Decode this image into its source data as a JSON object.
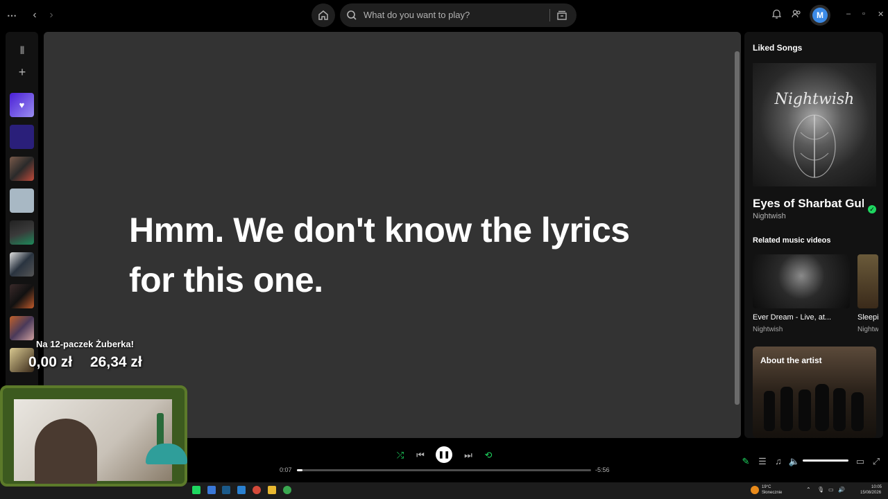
{
  "topbar": {
    "menu_icon": "more-horizontal-icon",
    "search_placeholder": "What do you want to play?",
    "avatar_initial": "M"
  },
  "sidebar": {
    "tiles": [
      {
        "name": "liked-songs",
        "color": "#6b3df0"
      },
      {
        "name": "playlist-2",
        "color": "#3a2a8f"
      },
      {
        "name": "playlist-3",
        "color": "#6a5040"
      },
      {
        "name": "playlist-4",
        "color": "#9aa6b0"
      },
      {
        "name": "playlist-5",
        "color": "#1a1a1a"
      },
      {
        "name": "playlist-6",
        "color": "#3a4650"
      },
      {
        "name": "playlist-7",
        "color": "#2a2020"
      },
      {
        "name": "playlist-8",
        "color": "#8a4a2a"
      },
      {
        "name": "playlist-9",
        "color": "#c9b48a"
      }
    ]
  },
  "main": {
    "lyrics_message": "Hmm. We don't know the lyrics for this one."
  },
  "right_panel": {
    "header": "Liked Songs",
    "cover_text": "Nightwish",
    "song_title": "Eyes of Sharbat Gula",
    "song_artist": "Nightwish",
    "related_header": "Related music videos",
    "videos": [
      {
        "title": "Ever Dream - Live, at...",
        "artist": "Nightwish"
      },
      {
        "title": "Sleeping Sun",
        "artist": "Nightwish"
      }
    ],
    "about_header": "About the artist"
  },
  "player": {
    "elapsed": "0:07",
    "remaining": "-5:56",
    "progress_fraction": 0.02,
    "volume_fraction": 1.0
  },
  "overlay": {
    "goal_title": "Na 12-paczek Żuberka!",
    "current_amount": "0,00 zł",
    "target_amount": "26,34 zł"
  },
  "taskbar": {
    "weather_temp": "19°C",
    "weather_desc": "Słonecznie",
    "clock_time": "10:05",
    "clock_date": "15/08/2026"
  },
  "colors": {
    "accent": "#1ed760",
    "main_bg": "#333333",
    "panel_bg": "#121212"
  }
}
